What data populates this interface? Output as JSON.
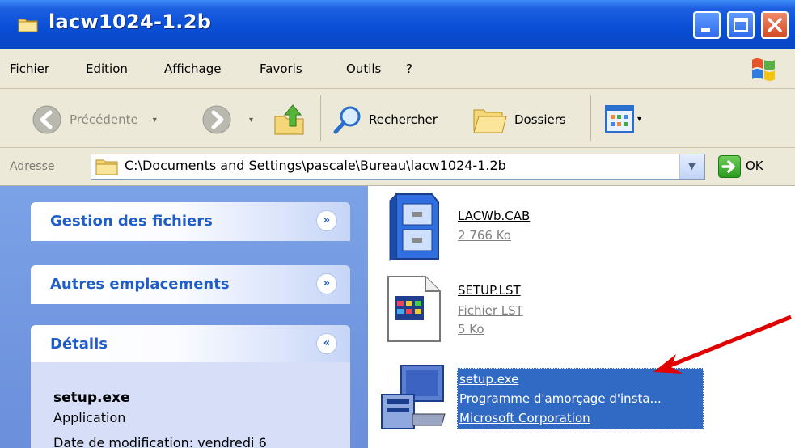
{
  "window": {
    "title": "lacw1024-1.2b",
    "controls": [
      "minimize",
      "maximize",
      "close"
    ]
  },
  "menu": {
    "items": [
      "Fichier",
      "Edition",
      "Affichage",
      "Favoris",
      "Outils",
      "?"
    ]
  },
  "toolbar": {
    "back_label": "Précédente",
    "search_label": "Rechercher",
    "folders_label": "Dossiers"
  },
  "address": {
    "label": "Adresse",
    "value": "C:\\Documents and Settings\\pascale\\Bureau\\lacw1024-1.2b",
    "go_label": "OK"
  },
  "task_panel": {
    "sections": [
      {
        "title": "Gestion des fichiers",
        "state": "collapsed"
      },
      {
        "title": "Autres emplacements",
        "state": "collapsed"
      },
      {
        "title": "Détails",
        "state": "expanded"
      }
    ],
    "details": {
      "name": "setup.exe",
      "type": "Application",
      "date": "Date de modification: vendredi 6"
    }
  },
  "files": [
    {
      "name": "LACWb.CAB",
      "lines": [
        "2 766 Ko"
      ],
      "icon": "cabinet-file-icon",
      "selected": false
    },
    {
      "name": "SETUP.LST",
      "lines": [
        "Fichier LST",
        "5 Ko"
      ],
      "icon": "lst-file-icon",
      "selected": false
    },
    {
      "name": "setup.exe",
      "lines": [
        "Programme d'amorçage d'insta...",
        "Microsoft Corporation"
      ],
      "icon": "setup-exe-icon",
      "selected": true
    }
  ],
  "colors": {
    "titlebar": "#0a4fd6",
    "selection": "#316ac5",
    "taskpanel": "#7ba2e7",
    "annotation_arrow": "#e00000"
  }
}
